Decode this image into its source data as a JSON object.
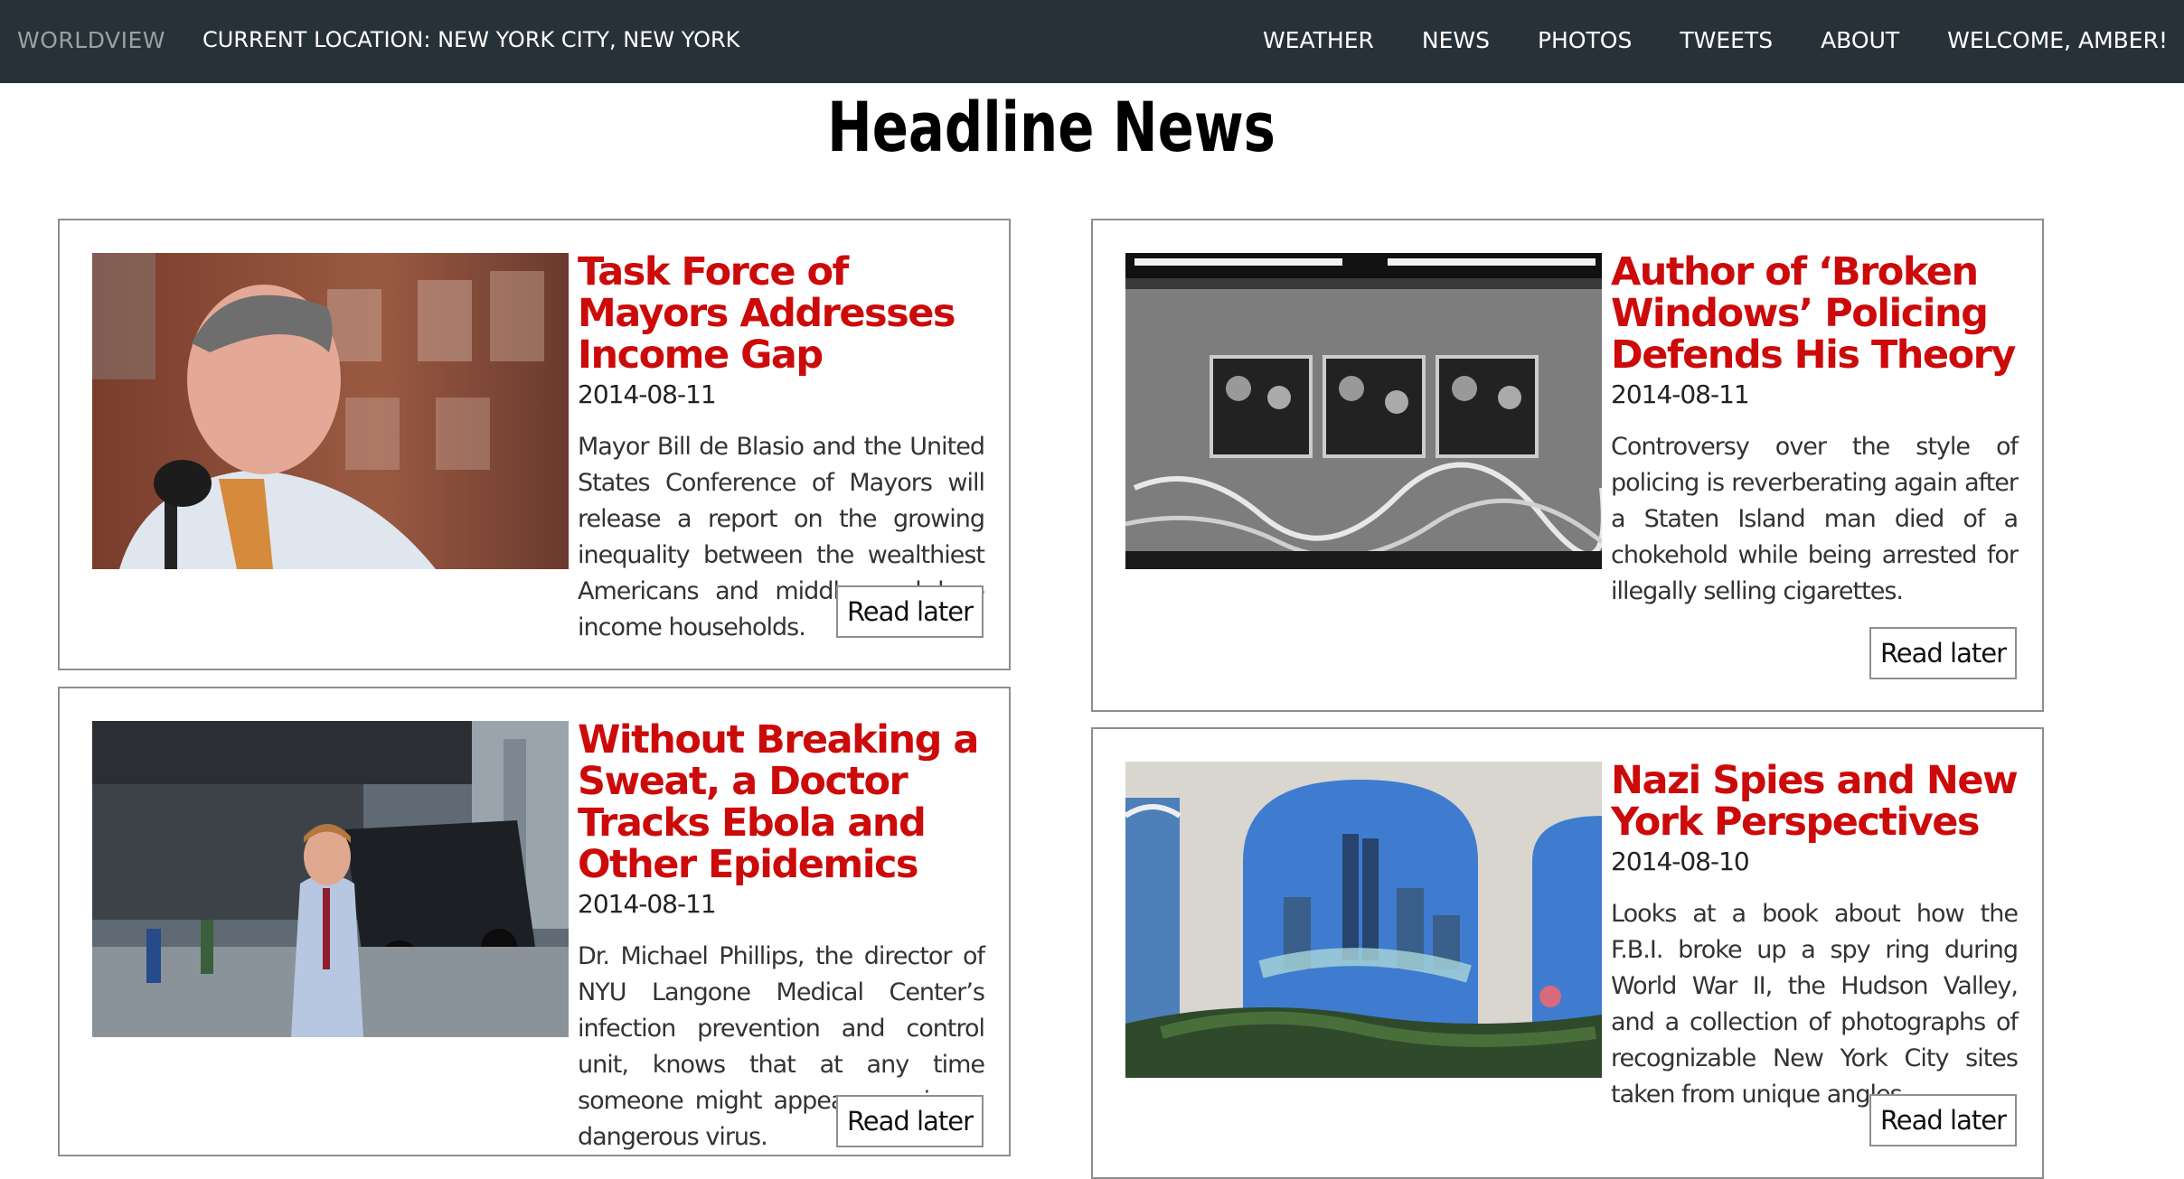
{
  "navbar": {
    "brand": "WORLDVIEW",
    "location": "CURRENT LOCATION: NEW YORK CITY, NEW YORK",
    "links": [
      "WEATHER",
      "NEWS",
      "PHOTOS",
      "TWEETS",
      "ABOUT",
      "WELCOME, AMBER!"
    ]
  },
  "page_title": "Headline News",
  "articles": [
    {
      "title": "Task Force of Mayors Addresses Income Gap",
      "date": "2014-08-11",
      "description": "Mayor Bill de Blasio and the United States Conference of Mayors will release a report on the growing inequality between the wealthiest Americans and middle- and low-income households.",
      "button": "Read later",
      "image": "mayor-speaking-photo"
    },
    {
      "title": "Author of ‘Broken Windows’ Policing Defends His Theory",
      "date": "2014-08-11",
      "description": "Controversy over the style of policing is reverberating again after a Staten Island man died of a chokehold while being arrested for illegally selling cigarettes.",
      "button": "Read later",
      "image": "subway-car-graffiti-photo"
    },
    {
      "title": "Without Breaking a Sweat, a Doctor Tracks Ebola and Other Epidemics",
      "date": "2014-08-11",
      "description": "Dr. Michael Phillips, the director of NYU Langone Medical Center’s infection prevention and control unit, knows that at any time someone might appear carrying a dangerous virus.",
      "button": "Read later",
      "image": "doctor-street-photo"
    },
    {
      "title": "Nazi Spies and New York Perspectives",
      "date": "2014-08-10",
      "description": "Looks at a book about how the F.B.I. broke up a spy ring during World War II, the Hudson Valley, and a collection of photographs of recognizable New York City sites taken from unique angles.",
      "button": "Read later",
      "image": "skyline-mural-photo"
    }
  ]
}
